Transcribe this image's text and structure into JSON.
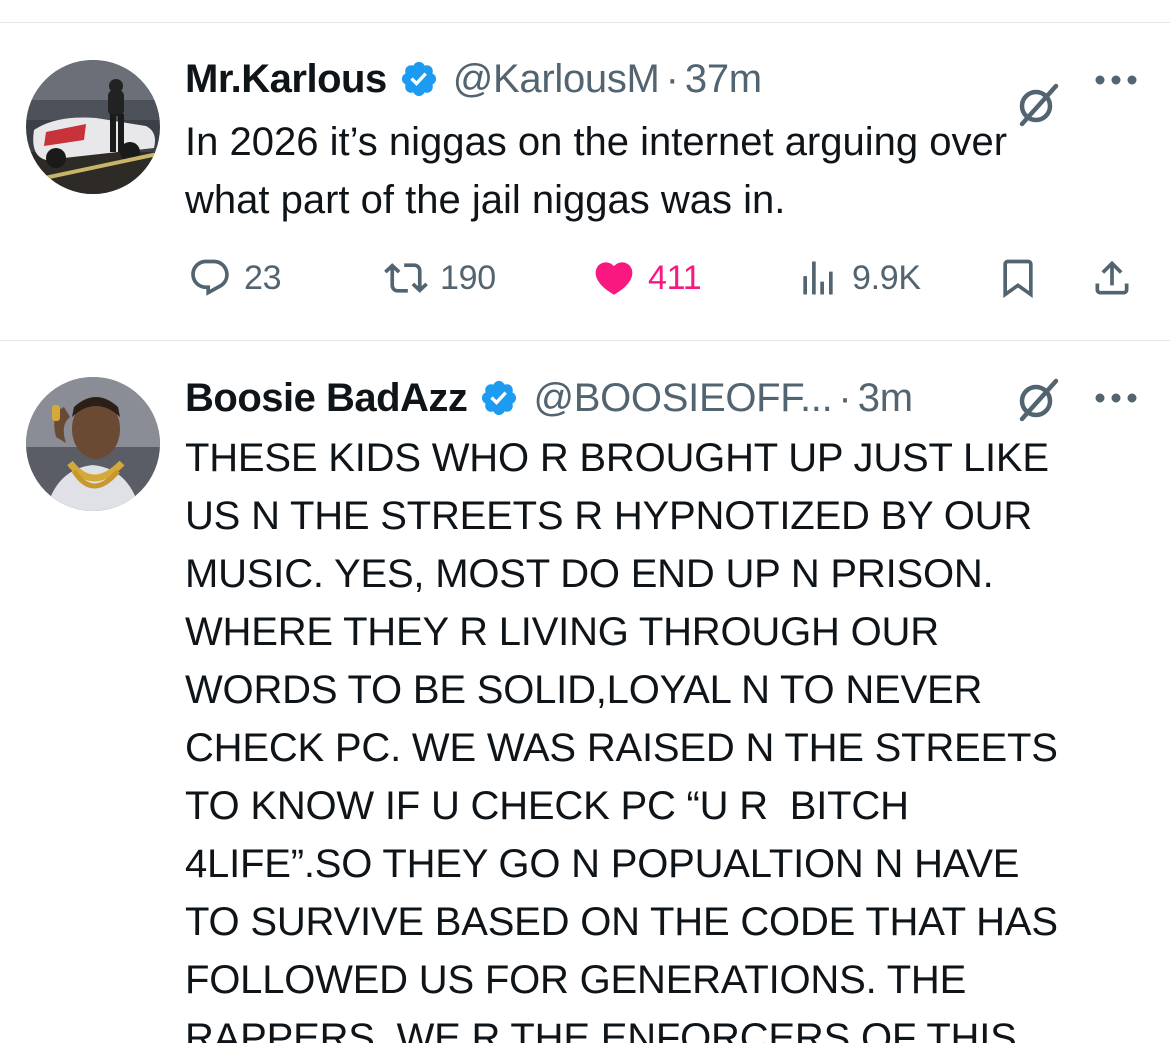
{
  "tweets": [
    {
      "name": "Mr.Karlous",
      "handle": "@KarlousM",
      "separator": "·",
      "time": "37m",
      "text": "In 2026 it’s niggas on the internet arguing over\nwhat part of the jail niggas was in.",
      "replies": "23",
      "retweets": "190",
      "likes": "411",
      "views": "9.9K"
    },
    {
      "name": "Boosie BadAzz",
      "handle": "@BOOSIEOFF...",
      "separator": "·",
      "time": "3m",
      "text": "THESE KIDS WHO R BROUGHT UP JUST LIKE\nUS N THE STREETS R HYPNOTIZED BY OUR\nMUSIC. YES, MOST DO END UP N PRISON.\nWHERE THEY R LIVING THROUGH OUR\nWORDS TO BE SOLID,LOYAL N TO NEVER\nCHECK PC. WE WAS RAISED N THE STREETS\nTO KNOW IF U CHECK PC “U R  BITCH\n4LIFE”.SO THEY GO N POPUALTION N HAVE\nTO SURVIVE BASED ON THE CODE THAT HAS\nFOLLOWED US FOR GENERATIONS. THE\nRAPPERS. WE R THE ENFORCERS OF THIS"
    }
  ],
  "colors": {
    "verified": "#1d9bf0",
    "like": "#f91880",
    "secondary": "#536471",
    "divider": "#e3e6e8"
  },
  "icons": {
    "verified": "verified-badge-icon",
    "grok": "grok-icon",
    "more": "more-options-icon",
    "reply": "reply-icon",
    "retweet": "retweet-icon",
    "like": "heart-filled-icon",
    "views": "views-icon",
    "bookmark": "bookmark-icon",
    "share": "share-icon"
  }
}
